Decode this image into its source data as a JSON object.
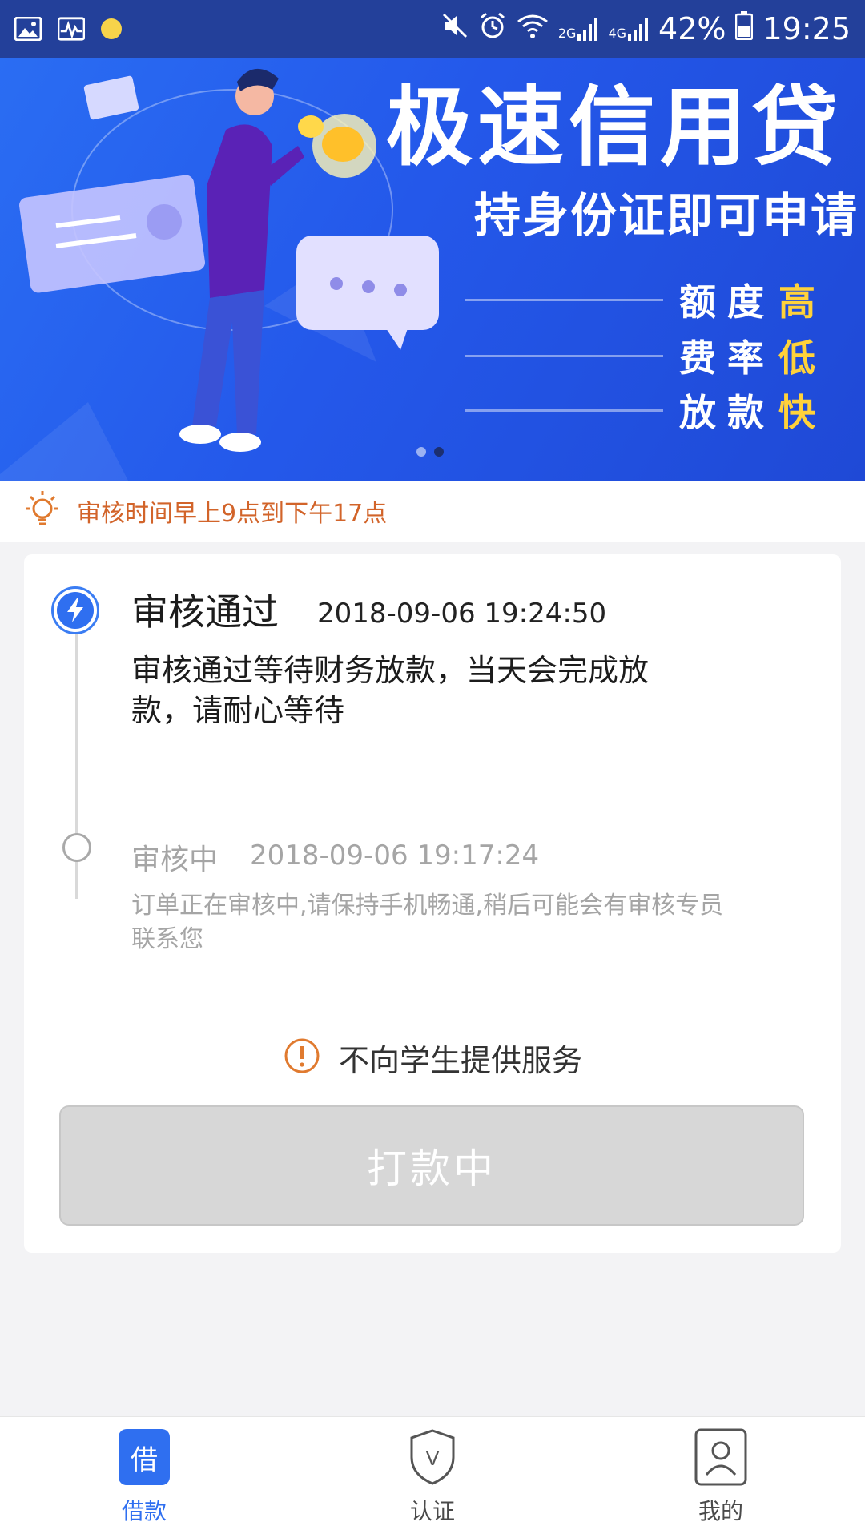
{
  "status_bar": {
    "battery": "42%",
    "time": "19:25",
    "net_2g": "2G",
    "net_4g": "4G",
    "icons": [
      "gallery-icon",
      "activity-icon",
      "notification-dot",
      "mute-icon",
      "alarm-icon",
      "wifi-icon",
      "signal-icon",
      "battery-icon"
    ]
  },
  "banner": {
    "title": "极速信用贷",
    "subtitle": "持身份证即可申请",
    "features": [
      {
        "label": "额度",
        "accent": "高"
      },
      {
        "label": "费率",
        "accent": "低"
      },
      {
        "label": "放款",
        "accent": "快"
      }
    ],
    "pager_count": 2,
    "pager_active": 2
  },
  "notice": {
    "text": "审核时间早上9点到下午17点",
    "icon": "lightbulb-icon",
    "color": "#d2642a"
  },
  "timeline": {
    "steps": [
      {
        "title": "审核通过",
        "time": "2018-09-06 19:24:50",
        "desc": "审核通过等待财务放款，当天会完成放款，请耐心等待",
        "status": "active"
      },
      {
        "title": "审核中",
        "time": "2018-09-06 19:17:24",
        "desc": "订单正在审核中,请保持手机畅通,稍后可能会有审核专员联系您",
        "status": "pending"
      }
    ]
  },
  "warning": {
    "text": "不向学生提供服务",
    "icon": "warning-circle-icon"
  },
  "action_button": {
    "label": "打款中",
    "enabled": false
  },
  "bottom_nav": {
    "items": [
      {
        "label": "借款",
        "icon_text": "借",
        "icon": "borrow-icon",
        "active": true
      },
      {
        "label": "认证",
        "icon_text": "V",
        "icon": "shield-icon",
        "active": false
      },
      {
        "label": "我的",
        "icon": "user-icon",
        "active": false
      }
    ]
  },
  "colors": {
    "primary": "#2f6ff0",
    "status_bar": "#23409a",
    "accent_yellow": "#ffd23a",
    "notice_orange": "#d2642a"
  }
}
